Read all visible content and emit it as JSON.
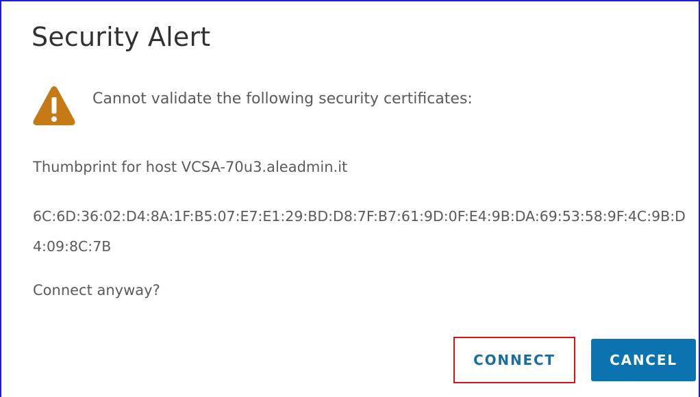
{
  "dialog": {
    "title": "Security Alert",
    "warning_text": "Cannot validate the following security certificates:",
    "thumbprint_label": "Thumbprint for host VCSA-70u3.aleadmin.it",
    "thumbprint_value": "6C:6D:36:02:D4:8A:1F:B5:07:E7:E1:29:BD:D8:7F:B7:61:9D:0F:E4:9B:DA:69:53:58:9F:4C:9B:D4:09:8C:7B",
    "question": "Connect anyway?",
    "icon": "warning-triangle-icon"
  },
  "buttons": {
    "connect_label": "CONNECT",
    "cancel_label": "CANCEL"
  },
  "colors": {
    "warning_icon": "#c57a16",
    "cancel_button": "#0a73b0",
    "connect_text": "#1a6da0",
    "highlight_box": "#d9101c",
    "frame_border": "#1d1dd6"
  }
}
